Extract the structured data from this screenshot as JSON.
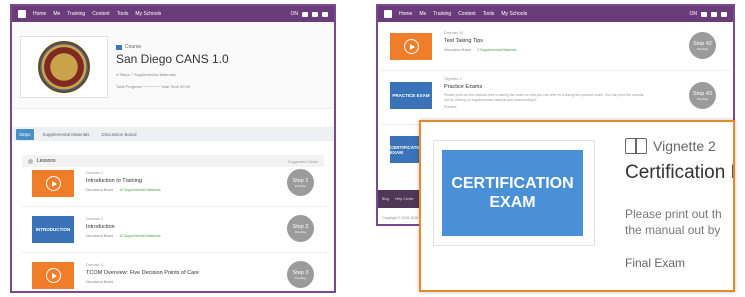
{
  "nav": {
    "items": [
      "Home",
      "Me",
      "Training",
      "Content",
      "Tools",
      "My Schools"
    ],
    "right_label": "ON"
  },
  "course": {
    "tag": "Course",
    "title": "San Diego CANS 1.0",
    "meta": "4 Steps   7 Supplemental Materials",
    "progress": "Total Progress ──────   Total Time 00:00"
  },
  "tabs": [
    "Steps",
    "Supplemental Materials",
    "Discussion Board"
  ],
  "section": {
    "title": "Lessons",
    "note": "Suggested Order"
  },
  "lessons": [
    {
      "thumb_style": "orange",
      "thumb_text": "",
      "who": "Domain 1",
      "title": "Introduction to Training",
      "links": [
        "Discussion Board",
        "10 Supplemental Materials"
      ],
      "step": "Step 1",
      "status": "Pending"
    },
    {
      "thumb_style": "blue",
      "thumb_text": "INTRODUCTION",
      "who": "Domain 2",
      "title": "Introduction",
      "links": [
        "Discussion Board",
        "12 Supplemental Materials"
      ],
      "step": "Step 2",
      "status": "Pending"
    },
    {
      "thumb_style": "orange",
      "thumb_text": "",
      "who": "Domain 3",
      "title": "TCOM Overview: Five Decision Points of Care",
      "links": [
        "Discussion Board"
      ],
      "step": "Step 3",
      "status": "Pending"
    }
  ],
  "right_lessons": [
    {
      "thumb_style": "orange",
      "thumb_text": "",
      "who": "Domain 10",
      "title": "Test Taking Tips",
      "links": [
        "Discussion Board",
        "2 Supplemental Materials"
      ],
      "desc": "",
      "step": "Step 42",
      "status": "Pending"
    },
    {
      "thumb_style": "blue",
      "thumb_text": "PRACTICE EXAM",
      "who": "Vignette 1",
      "title": "Practice Exams",
      "links": [],
      "desc": "Please print out the manual prior to taking the exam so that you can refer to it during the practice exam. You can print the manual out by clicking on supplemental material and downloading it.",
      "extra": "Practice",
      "step": "Step 43",
      "status": "Pending"
    },
    {
      "thumb_style": "blue",
      "thumb_text": "CERTIFICATION EXAM",
      "who": "",
      "title": "",
      "links": [],
      "desc": "",
      "step": "",
      "status": ""
    }
  ],
  "footer": {
    "items": [
      "Blog",
      "Help Center"
    ],
    "copyright": "Copyright © 2015-2016"
  },
  "zoom": {
    "thumb_text": "CERTIFICATION EXAM",
    "label": "Vignette 2",
    "title": "Certification E",
    "desc_line1": "Please print out th",
    "desc_line2": "the manual out by",
    "final": "Final Exam"
  }
}
